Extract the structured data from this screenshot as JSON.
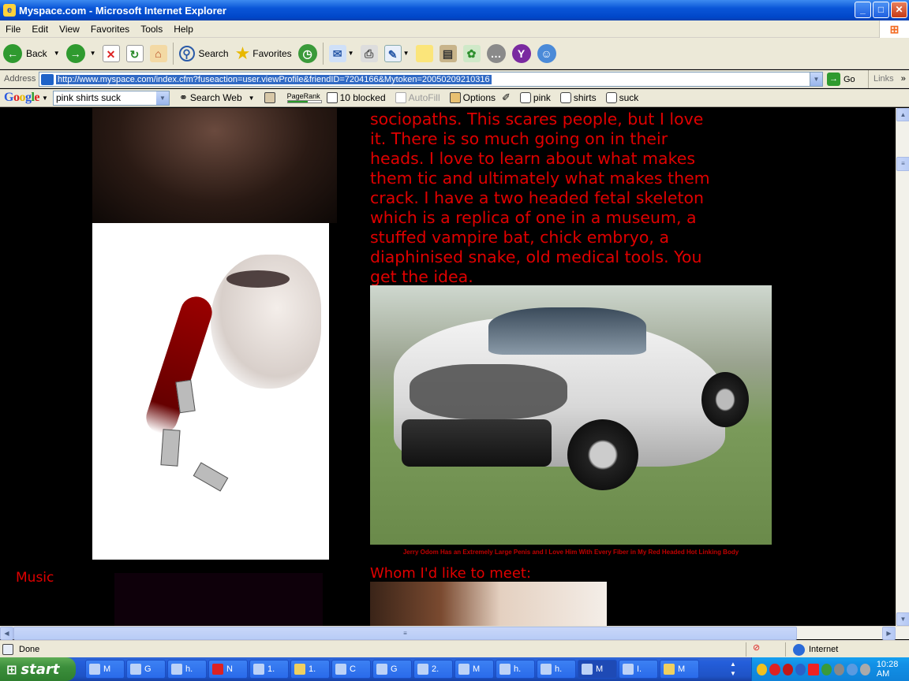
{
  "window": {
    "title": "Myspace.com - Microsoft Internet Explorer",
    "controls": {
      "minimize": "_",
      "maximize": "□",
      "close": "✕"
    }
  },
  "menu": [
    "File",
    "Edit",
    "View",
    "Favorites",
    "Tools",
    "Help"
  ],
  "toolbar": {
    "back_label": "Back",
    "search_label": "Search",
    "favorites_label": "Favorites"
  },
  "address": {
    "label": "Address",
    "url": "http://www.myspace.com/index.cfm?fuseaction=user.viewProfile&friendID=7204166&Mytoken=20050209210316",
    "go_label": "Go",
    "links_label": "Links"
  },
  "googlebar": {
    "logo": "Google",
    "query": "pink shirts suck",
    "search_web": "Search Web",
    "pagerank": "PageRank",
    "blocked": "10 blocked",
    "autofill": "AutoFill",
    "options": "Options",
    "terms": [
      "pink",
      "shirts",
      "suck"
    ]
  },
  "page": {
    "bio_text": "sociopaths. This scares people, but I love it. There is so much going on in their heads. I love to learn about what makes them tic and ultimately what makes them crack. I have a two headed fetal skeleton which is a replica of one in a museum, a stuffed vampire bat, chick embryo, a diaphinised snake, old medical tools. You get the idea.",
    "car_caption": "Jerry Odom Has an Extremely Large Penis and I Love Him With Every Fiber in My Red Headed Hot Linking Body",
    "music_heading": "Music",
    "meet_heading": "Whom I'd like to meet:"
  },
  "status": {
    "text": "Done",
    "zone": "Internet"
  },
  "taskbar": {
    "start_label": "start",
    "tasks": [
      "M",
      "G",
      "h.",
      "N",
      "1.",
      "1.",
      "C",
      "G",
      "2.",
      "M",
      "h.",
      "h.",
      "M",
      "I.",
      "M"
    ],
    "active_index": 12,
    "clock": "10:28 AM"
  }
}
